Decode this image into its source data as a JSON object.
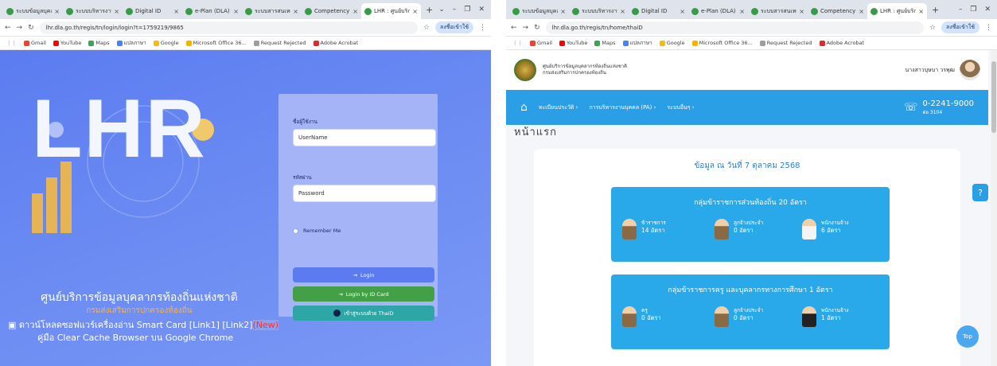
{
  "left_window": {
    "tabs": [
      {
        "title": "ระบบข้อมูลบุคลากร"
      },
      {
        "title": "ระบบบริหารงานบุคคล"
      },
      {
        "title": "Digital ID"
      },
      {
        "title": "e-Plan (DLA)"
      },
      {
        "title": "ระบบสารสนเทศ"
      },
      {
        "title": "Competency Assessment"
      },
      {
        "title": "LHR : ศูนย์บริการข้อมูล"
      }
    ],
    "new_tab": "+",
    "window_controls": [
      "⌄",
      "–",
      "❐",
      "✕"
    ],
    "url": "lhr.dla.go.th/regis/tn/login/login?t=1759219/9865",
    "account": "ลงชื่อเข้าใช้",
    "bookmarks": [
      "Gmail",
      "YouTube",
      "Maps",
      "แปลภาษา",
      "Google",
      "Microsoft Office 36...",
      "Request Rejected",
      "Adobe Acrobat"
    ],
    "page": {
      "hero_text": "LHR",
      "centre_name": "ศูนย์บริการข้อมูลบุคลากรท้องถิ่นแห่งชาติ",
      "dept_name": "กรมส่งเสริมการปกครองท้องถิ่น",
      "download_text": "ดาวน์โหลดซอฟแวร์เครื่องอ่าน Smart Card [Link1] [Link2]",
      "download_new": "(New)",
      "cache_text": "คู่มือ Clear Cache Browser บน Google Chrome",
      "username_label": "ชื่อผู้ใช้งาน",
      "username_placeholder": "UserName",
      "password_label": "รหัสผ่าน",
      "password_placeholder": "Password",
      "remember_label": "Remember Me",
      "login_button": "Login",
      "idcard_button": "Login by ID Card",
      "thaid_button": "เข้าสู่ระบบด้วย ThaiD"
    }
  },
  "right_window": {
    "tabs": [
      {
        "title": "ระบบข้อมูลบุคลากร"
      },
      {
        "title": "ระบบบริหารงานบุคคล"
      },
      {
        "title": "Digital ID"
      },
      {
        "title": "e-Plan (DLA)"
      },
      {
        "title": "ระบบสารสนเทศ"
      },
      {
        "title": "Competency Assessment"
      },
      {
        "title": "LHR : ศูนย์บริการข้อมูล"
      }
    ],
    "new_tab": "+",
    "window_controls": [
      "–",
      "❐",
      "✕"
    ],
    "url": "lhr.dla.go.th/regis/tn/home/thaiD",
    "account": "ลงชื่อเข้าใช้",
    "bookmarks": [
      "Gmail",
      "YouTube",
      "Maps",
      "แปลภาษา",
      "Google",
      "Microsoft Office 36...",
      "Request Rejected",
      "Adobe Acrobat"
    ],
    "page": {
      "org_line1": "ศูนย์บริการข้อมูลบุคลากรท้องถิ่นแห่งชาติ",
      "org_line2": "กรมส่งเสริมการปกครองท้องถิ่น",
      "user_name": "นางสาวบุษบา วรพุฒ",
      "nav": [
        "ทะเบียนประวัติ ›",
        "การบริหารงานบุคคล (PA) ›",
        "ระบบอื่นๆ ›"
      ],
      "phone": "0-2241-9000",
      "phone_ext": "ต่อ 3104",
      "page_title": "หน้าแรก",
      "date_line": "ข้อมูล ณ วันที่ 7 ตุลาคม 2568",
      "group1": {
        "title": "กลุ่มข้าราชการส่วนท้องถิ่น 20 อัตรา",
        "items": [
          {
            "label": "ข้าราชการ",
            "value": "14 อัตรา",
            "color": "brown"
          },
          {
            "label": "ลูกจ้างประจำ",
            "value": "0 อัตรา",
            "color": "brown"
          },
          {
            "label": "พนักงานจ้าง",
            "value": "6 อัตรา",
            "color": "white"
          }
        ]
      },
      "group2": {
        "title": "กลุ่มข้าราชการครู และบุคลากรทางการศึกษา 1 อัตรา",
        "items": [
          {
            "label": "ครู",
            "value": "0 อัตรา",
            "color": "brown"
          },
          {
            "label": "ลูกจ้างประจำ",
            "value": "0 อัตรา",
            "color": "brown"
          },
          {
            "label": "พนักงานจ้าง",
            "value": "1 อัตรา",
            "color": "black"
          }
        ]
      },
      "help_button": "?",
      "top_button": "Top"
    }
  },
  "colors": {
    "login_bg": "#6d8df3",
    "login_button": "#5b7cf0",
    "idcard_button": "#43a047",
    "thaid_button": "#2ea6a8",
    "navbar": "#2b9fe6",
    "stat_box": "#2aa9ea",
    "dept_text": "#ffb13b",
    "new_badge": "#ff2d2d"
  }
}
